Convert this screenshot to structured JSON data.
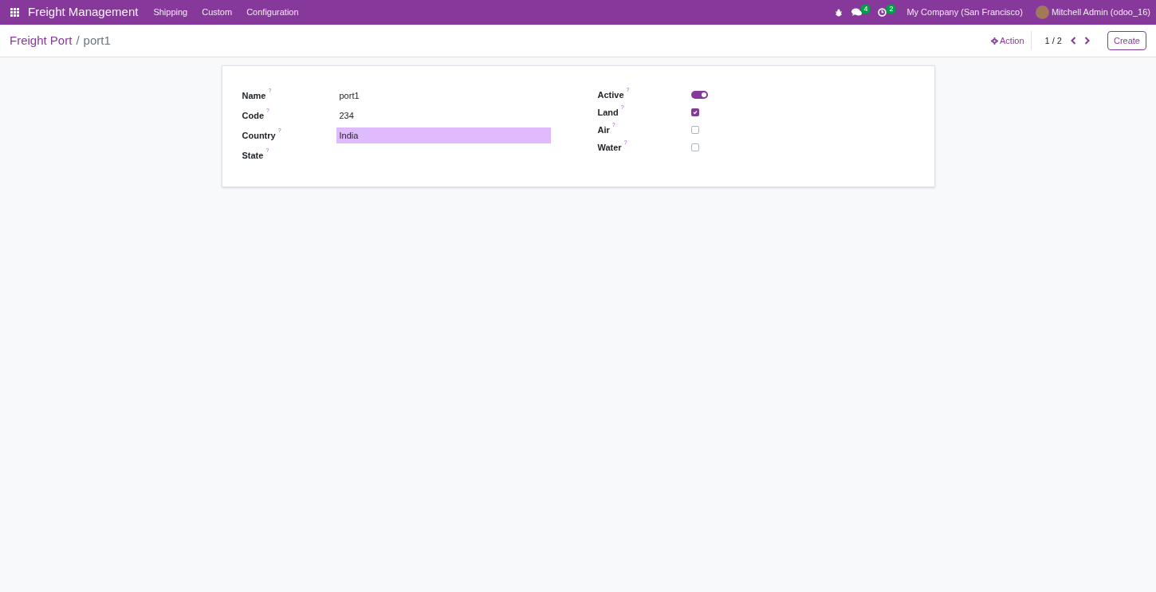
{
  "navbar": {
    "app_title": "Freight Management",
    "menu": [
      "Shipping",
      "Custom",
      "Configuration"
    ],
    "messages_count": "4",
    "activities_count": "2",
    "company": "My Company (San Francisco)",
    "user": "Mitchell Admin (odoo_16)"
  },
  "breadcrumb": {
    "parent": "Freight Port",
    "separator": "/",
    "current": "port1"
  },
  "control_panel": {
    "action": "Action",
    "pager": "1 / 2",
    "create": "Create"
  },
  "form": {
    "left_fields": [
      {
        "label": "Name",
        "help": "?",
        "value": "port1",
        "focused": false
      },
      {
        "label": "Code",
        "help": "?",
        "value": "234",
        "focused": false
      },
      {
        "label": "Country",
        "help": "?",
        "value": "India",
        "focused": true
      },
      {
        "label": "State",
        "help": "?",
        "focused": false
      }
    ],
    "right_fields": [
      {
        "label": "Active",
        "help": "?",
        "kind": "toggle",
        "on": true
      },
      {
        "label": "Land",
        "help": "?",
        "kind": "checkbox",
        "checked": true
      },
      {
        "label": "Air",
        "help": "?",
        "kind": "checkbox",
        "checked": false
      },
      {
        "label": "Water",
        "help": "?",
        "kind": "checkbox",
        "checked": false
      }
    ]
  }
}
